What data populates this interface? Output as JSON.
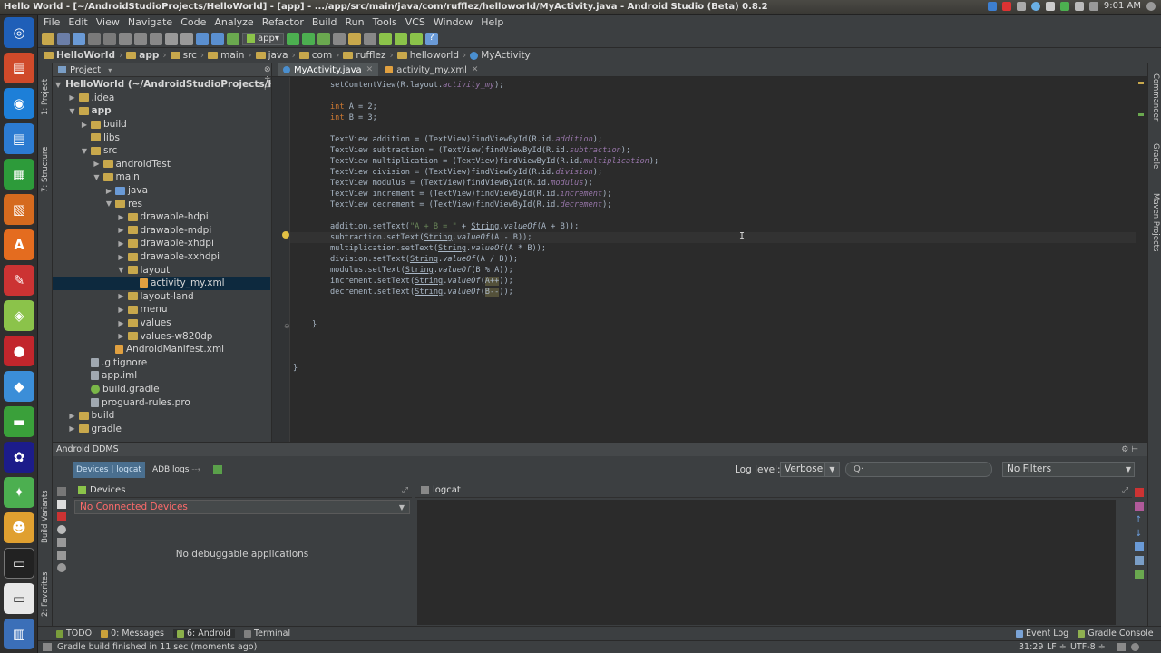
{
  "window": {
    "title": "Hello World - [~/AndroidStudioProjects/HelloWorld] - [app] - .../app/src/main/java/com/rufflez/helloworld/MyActivity.java - Android Studio (Beta) 0.8.2",
    "clock": "9:01 AM"
  },
  "menu": [
    "File",
    "Edit",
    "View",
    "Navigate",
    "Code",
    "Analyze",
    "Refactor",
    "Build",
    "Run",
    "Tools",
    "VCS",
    "Window",
    "Help"
  ],
  "toolbar": {
    "run_config": "app"
  },
  "breadcrumbs": [
    "HelloWorld",
    "app",
    "src",
    "main",
    "java",
    "com",
    "rufflez",
    "helloworld",
    "MyActivity"
  ],
  "left_strip": {
    "project_tab": "1: Project",
    "structure_tab": "7: Structure",
    "build_variants_tab": "Build Variants",
    "favorites_tab": "2: Favorites"
  },
  "right_strip": {
    "commander_tab": "Commander",
    "gradle_tab": "Gradle",
    "maven_tab": "Maven Projects"
  },
  "project_panel": {
    "header": "Project",
    "tree": [
      {
        "label": "HelloWorld (~/AndroidStudioProjects/HelloW",
        "depth": 0,
        "arrow": "▼",
        "icon": "folder",
        "bold": true
      },
      {
        "label": ".idea",
        "depth": 1,
        "arrow": "▶",
        "icon": "folder"
      },
      {
        "label": "app",
        "depth": 1,
        "arrow": "▼",
        "icon": "folder",
        "bold": true
      },
      {
        "label": "build",
        "depth": 2,
        "arrow": "▶",
        "icon": "folder"
      },
      {
        "label": "libs",
        "depth": 2,
        "arrow": "",
        "icon": "folder"
      },
      {
        "label": "src",
        "depth": 2,
        "arrow": "▼",
        "icon": "folder"
      },
      {
        "label": "androidTest",
        "depth": 3,
        "arrow": "▶",
        "icon": "folder"
      },
      {
        "label": "main",
        "depth": 3,
        "arrow": "▼",
        "icon": "folder"
      },
      {
        "label": "java",
        "depth": 4,
        "arrow": "▶",
        "icon": "folder-blue"
      },
      {
        "label": "res",
        "depth": 4,
        "arrow": "▼",
        "icon": "folder"
      },
      {
        "label": "drawable-hdpi",
        "depth": 5,
        "arrow": "▶",
        "icon": "folder"
      },
      {
        "label": "drawable-mdpi",
        "depth": 5,
        "arrow": "▶",
        "icon": "folder"
      },
      {
        "label": "drawable-xhdpi",
        "depth": 5,
        "arrow": "▶",
        "icon": "folder"
      },
      {
        "label": "drawable-xxhdpi",
        "depth": 5,
        "arrow": "▶",
        "icon": "folder"
      },
      {
        "label": "layout",
        "depth": 5,
        "arrow": "▼",
        "icon": "folder"
      },
      {
        "label": "activity_my.xml",
        "depth": 6,
        "arrow": "",
        "icon": "xml",
        "selected": true
      },
      {
        "label": "layout-land",
        "depth": 5,
        "arrow": "▶",
        "icon": "folder"
      },
      {
        "label": "menu",
        "depth": 5,
        "arrow": "▶",
        "icon": "folder"
      },
      {
        "label": "values",
        "depth": 5,
        "arrow": "▶",
        "icon": "folder"
      },
      {
        "label": "values-w820dp",
        "depth": 5,
        "arrow": "▶",
        "icon": "folder"
      },
      {
        "label": "AndroidManifest.xml",
        "depth": 4,
        "arrow": "",
        "icon": "xml"
      },
      {
        "label": ".gitignore",
        "depth": 2,
        "arrow": "",
        "icon": "file"
      },
      {
        "label": "app.iml",
        "depth": 2,
        "arrow": "",
        "icon": "file"
      },
      {
        "label": "build.gradle",
        "depth": 2,
        "arrow": "",
        "icon": "gradle"
      },
      {
        "label": "proguard-rules.pro",
        "depth": 2,
        "arrow": "",
        "icon": "file"
      },
      {
        "label": "build",
        "depth": 1,
        "arrow": "▶",
        "icon": "folder"
      },
      {
        "label": "gradle",
        "depth": 1,
        "arrow": "▶",
        "icon": "folder"
      }
    ]
  },
  "editor": {
    "tabs": [
      {
        "label": "MyActivity.java",
        "active": true
      },
      {
        "label": "activity_my.xml",
        "active": false
      }
    ],
    "lines": [
      "setContentView(R.layout.activity_my);",
      "",
      "int A = 2;",
      "int B = 3;",
      "",
      "TextView addition = (TextView)findViewById(R.id.addition);",
      "TextView subtraction = (TextView)findViewById(R.id.subtraction);",
      "TextView multiplication = (TextView)findViewById(R.id.multiplication);",
      "TextView division = (TextView)findViewById(R.id.division);",
      "TextView modulus = (TextView)findViewById(R.id.modulus);",
      "TextView increment = (TextView)findViewById(R.id.increment);",
      "TextView decrement = (TextView)findViewById(R.id.decrement);",
      "",
      "addition.setText(\"A + B = \" + String.valueOf(A + B));",
      "subtraction.setText(String.valueOf(A - B));",
      "multiplication.setText(String.valueOf(A * B));",
      "division.setText(String.valueOf(A / B));",
      "modulus.setText(String.valueOf(B % A));",
      "increment.setText(String.valueOf(A++));",
      "decrement.setText(String.valueOf(B--));",
      "",
      "",
      "}",
      "",
      "",
      "",
      "}"
    ]
  },
  "ddms": {
    "header": "Android DDMS",
    "tab_devices_logcat": "Devices | logcat",
    "tab_adb_logs": "ADB logs",
    "log_level_label": "Log level:",
    "log_level_value": "Verbose",
    "search_placeholder": "Q·",
    "filter_value": "No Filters",
    "devices_title": "Devices",
    "devices_select": "No Connected Devices",
    "no_debuggable": "No debuggable applications",
    "logcat_title": "logcat"
  },
  "bottom_tabs": [
    {
      "label": "TODO",
      "color": "#7a9e3c"
    },
    {
      "label": "0: Messages",
      "color": "#c9a13b"
    },
    {
      "label": "6: Android",
      "color": "#8bb04a",
      "active": true
    },
    {
      "label": "Terminal",
      "color": "#808080"
    }
  ],
  "bottom_right_tabs": [
    {
      "label": "Event Log",
      "color": "#7aa3d6"
    },
    {
      "label": "Gradle Console",
      "color": "#8fb050"
    }
  ],
  "status": {
    "message": "Gradle build finished in 11 sec (moments ago)",
    "position": "31:29",
    "line_sep": "LF ÷",
    "encoding": "UTF-8 ÷"
  },
  "colors": {
    "keyword": "#cc7832",
    "field": "#9876aa",
    "string": "#6a8759",
    "selection": "#0d293e",
    "error_text": "#ff6b6b"
  }
}
